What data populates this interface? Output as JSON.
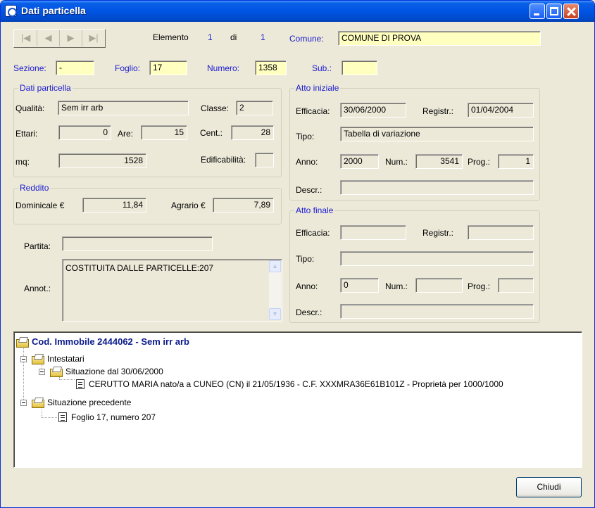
{
  "window": {
    "title": "Dati particella"
  },
  "nav": {
    "first": "|◀",
    "prev": "◀",
    "next": "▶",
    "last": "▶|",
    "elemento_label": "Elemento",
    "elemento_value": "1",
    "di_label": "di",
    "di_value": "1",
    "comune_label": "Comune:",
    "comune_value": "COMUNE DI PROVA"
  },
  "ids": {
    "sezione_label": "Sezione:",
    "sezione_value": "-",
    "foglio_label": "Foglio:",
    "foglio_value": "17",
    "numero_label": "Numero:",
    "numero_value": "1358",
    "sub_label": "Sub.:",
    "sub_value": ""
  },
  "dati_particella": {
    "title": "Dati particella",
    "qualita_label": "Qualità:",
    "qualita_value": "Sem irr arb",
    "classe_label": "Classe:",
    "classe_value": "2",
    "ettari_label": "Ettari:",
    "ettari_value": "0",
    "are_label": "Are:",
    "are_value": "15",
    "cent_label": "Cent.:",
    "cent_value": "28",
    "mq_label": "mq:",
    "mq_value": "1528",
    "edificabilita_label": "Edificabilità:",
    "edificabilita_value": ""
  },
  "reddito": {
    "title": "Reddito",
    "dominicale_label": "Dominicale €",
    "dominicale_value": "11,84",
    "agrario_label": "Agrario €",
    "agrario_value": "7,89"
  },
  "partita": {
    "label": "Partita:",
    "value": ""
  },
  "annot": {
    "label": "Annot.:",
    "value": "COSTITUITA DALLE PARTICELLE:207"
  },
  "atto_iniziale": {
    "title": "Atto iniziale",
    "efficacia_label": "Efficacia:",
    "efficacia_value": "30/06/2000",
    "registr_label": "Registr.:",
    "registr_value": "01/04/2004",
    "tipo_label": "Tipo:",
    "tipo_value": "Tabella di variazione",
    "anno_label": "Anno:",
    "anno_value": "2000",
    "num_label": "Num.:",
    "num_value": "3541",
    "prog_label": "Prog.:",
    "prog_value": "1",
    "descr_label": "Descr.:",
    "descr_value": ""
  },
  "atto_finale": {
    "title": "Atto finale",
    "efficacia_label": "Efficacia:",
    "efficacia_value": "",
    "registr_label": "Registr.:",
    "registr_value": "",
    "tipo_label": "Tipo:",
    "tipo_value": "",
    "anno_label": "Anno:",
    "anno_value": "0",
    "num_label": "Num.:",
    "num_value": "",
    "prog_label": "Prog.:",
    "prog_value": "",
    "descr_label": "Descr.:",
    "descr_value": ""
  },
  "tree": {
    "root": "Cod. Immobile 2444062 - Sem irr arb",
    "intestatari": "Intestatari",
    "situazione": "Situazione dal 30/06/2000",
    "owner": "CERUTTO MARIA nato/a a CUNEO (CN) il 21/05/1936 - C.F. XXXMRA36E61B101Z - Proprietà per 1000/1000",
    "precedente": "Situazione precedente",
    "foglio": "Foglio 17, numero 207"
  },
  "buttons": {
    "chiudi": "Chiudi"
  }
}
